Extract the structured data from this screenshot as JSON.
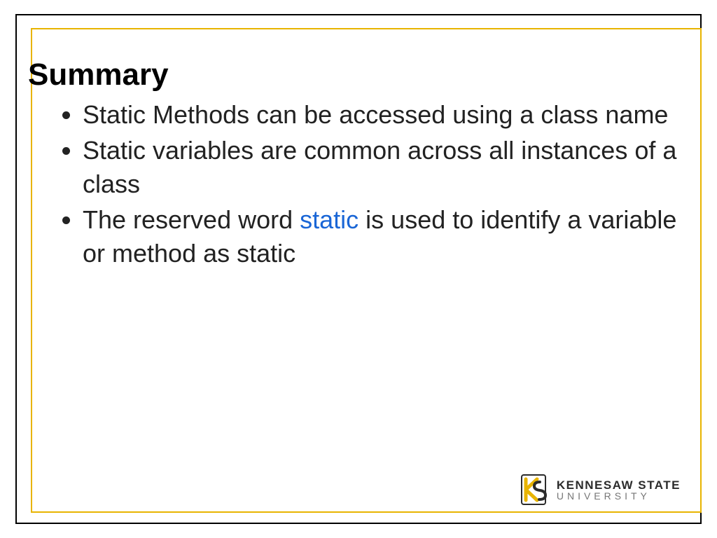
{
  "slide": {
    "title": "Summary",
    "bullets": [
      {
        "segments": [
          {
            "text": "Static Methods can be accessed using a class name"
          }
        ]
      },
      {
        "segments": [
          {
            "text": "Static variables are common across all instances of a class"
          }
        ]
      },
      {
        "segments": [
          {
            "text": "The reserved word "
          },
          {
            "text": "static",
            "class": "kw"
          },
          {
            "text": " is used to identify a variable or method as static"
          }
        ]
      }
    ]
  },
  "logo": {
    "line1": "KENNESAW STATE",
    "line2": "UNIVERSITY",
    "colors": {
      "gold": "#e8b400",
      "dark": "#2b2b2b"
    }
  }
}
